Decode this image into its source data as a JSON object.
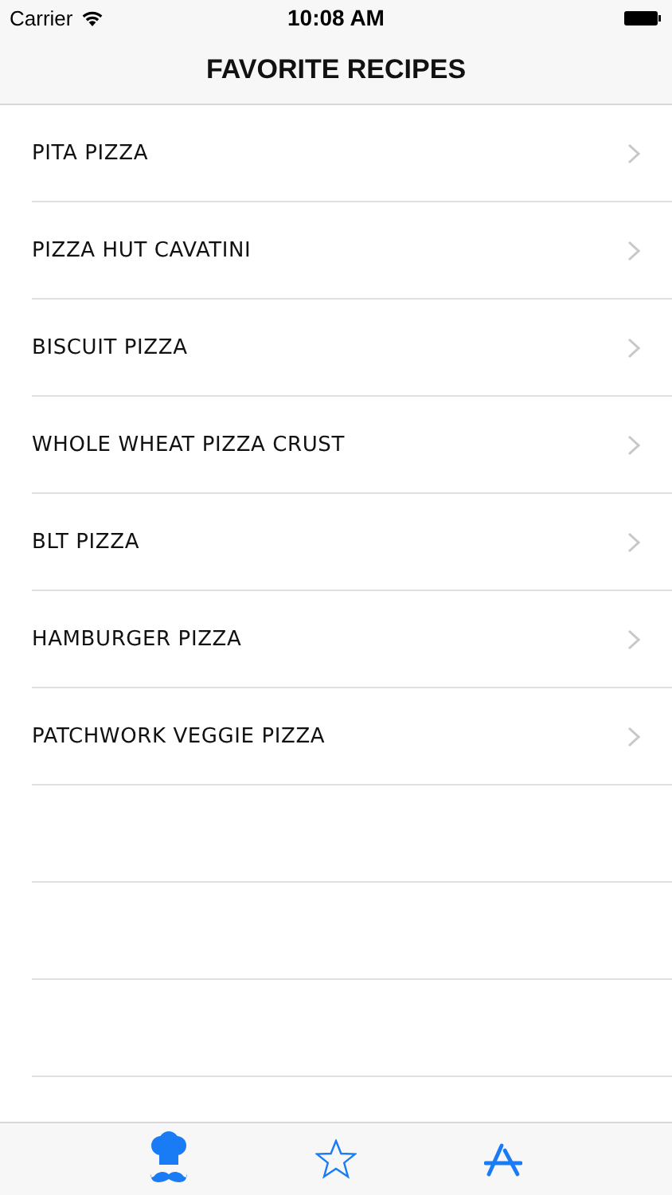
{
  "status_bar": {
    "carrier": "Carrier",
    "time": "10:08 AM"
  },
  "nav": {
    "title": "FAVORITE RECIPES"
  },
  "recipes": [
    {
      "name": "PITA PIZZA"
    },
    {
      "name": "PIZZA HUT CAVATINI"
    },
    {
      "name": "BISCUIT PIZZA"
    },
    {
      "name": "WHOLE WHEAT PIZZA CRUST"
    },
    {
      "name": "BLT PIZZA"
    },
    {
      "name": "HAMBURGER PIZZA"
    },
    {
      "name": "PATCHWORK VEGGIE PIZZA"
    }
  ],
  "tabs": [
    {
      "kind": "chef",
      "selected": true
    },
    {
      "kind": "star",
      "selected": false
    },
    {
      "kind": "appstore",
      "selected": false
    }
  ]
}
